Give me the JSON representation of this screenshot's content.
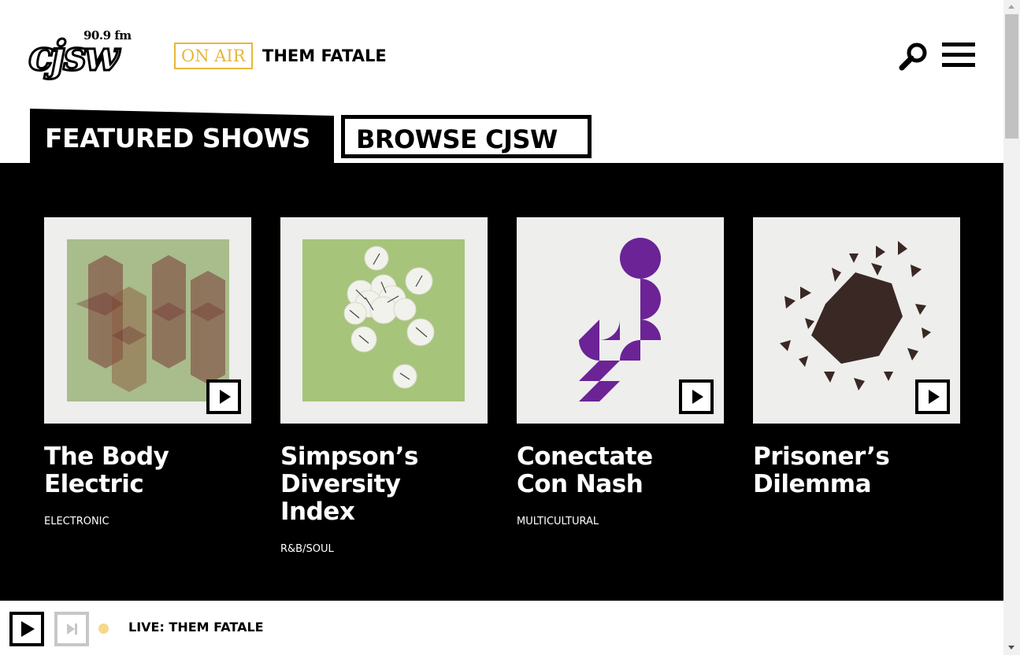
{
  "header": {
    "logo_freq": "90.9 fm",
    "logo_word": "cjsw",
    "on_air_label": "ON AIR",
    "on_air_show": "THEM FATALE",
    "search_icon": "search-icon",
    "menu_icon": "hamburger-menu-icon"
  },
  "tabs": {
    "featured": "FEATURED SHOWS",
    "browse": "BROWSE CJSW"
  },
  "shows": [
    {
      "title_line1": "The Body",
      "title_line2": "Electric",
      "title_line3": "",
      "genre": "ELECTRONIC",
      "has_play": true
    },
    {
      "title_line1": "Simpson’s",
      "title_line2": "Diversity",
      "title_line3": "Index",
      "genre": "R&B/SOUL",
      "has_play": false
    },
    {
      "title_line1": "Conectate",
      "title_line2": "Con Nash",
      "title_line3": "",
      "genre": "MULTICULTURAL",
      "has_play": true
    },
    {
      "title_line1": "Prisoner’s",
      "title_line2": "Dilemma",
      "title_line3": "",
      "genre": "",
      "has_play": true
    }
  ],
  "player": {
    "live_text": "LIVE: THEM FATALE",
    "play_icon": "play-icon",
    "skip_icon": "skip-forward-icon"
  },
  "colors": {
    "accent_gold": "#e8b73a",
    "panel_black": "#000000",
    "live_dot": "#f5d88a",
    "purple": "#6b2396",
    "sage": "#a9bf88"
  }
}
